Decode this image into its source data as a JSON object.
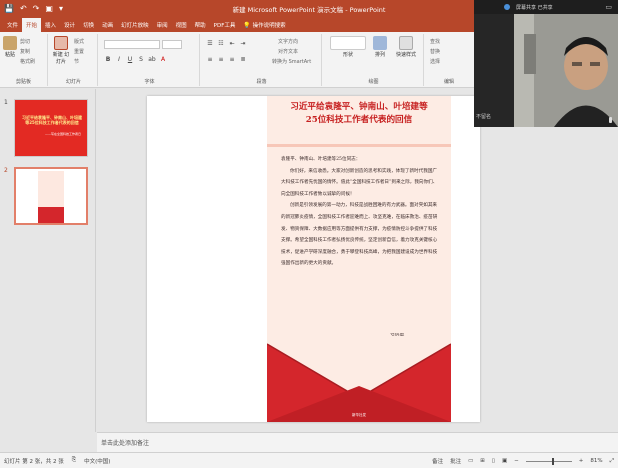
{
  "app": {
    "window_title": "新建 Microsoft PowerPoint 演示文稿 - PowerPoint",
    "quick_access": [
      "💾",
      "↶",
      "↷",
      "▣",
      "▾"
    ]
  },
  "tabs": [
    {
      "label": "文件"
    },
    {
      "label": "开始"
    },
    {
      "label": "插入"
    },
    {
      "label": "设计"
    },
    {
      "label": "切换"
    },
    {
      "label": "动画"
    },
    {
      "label": "幻灯片放映"
    },
    {
      "label": "审阅"
    },
    {
      "label": "视图"
    },
    {
      "label": "帮助"
    },
    {
      "label": "PDF工具"
    }
  ],
  "tell_me": "操作说明搜索",
  "ribbon": {
    "clipboard": {
      "paste": "粘贴",
      "cut": "剪切",
      "copy": "复制",
      "painter": "格式刷",
      "label": "剪贴板"
    },
    "slides": {
      "new_slide": "新建\n幻灯片",
      "layout": "版式",
      "reset": "重置",
      "section": "节",
      "label": "幻灯片"
    },
    "font": {
      "label": "字体",
      "format": [
        "B",
        "I",
        "U",
        "S",
        "ab",
        "A"
      ]
    },
    "paragraph": {
      "label": "段落",
      "convert_smartart": "转换为 SmartArt",
      "text_direction": "文字方向",
      "align_text": "对齐文本"
    },
    "drawing": {
      "shapes": "形状",
      "arrange": "排列",
      "quick_styles": "快速样式",
      "label": "绘图"
    },
    "editing": {
      "find": "查找",
      "replace": "替换",
      "select": "选择",
      "label": "编辑"
    }
  },
  "thumbnails": [
    {
      "num": "1",
      "title": "习近平给袁隆平、钟南山、叶培建等25位科技工作者代表的回信",
      "sub": "——写在全国科技工作者日"
    },
    {
      "num": "2"
    }
  ],
  "letter": {
    "title_line1": "习近平给袁隆平、钟南山、叶培建等",
    "title_line2": "25位科技工作者代表的回信",
    "salutation": "袁隆平、钟南山、叶培建等25位同志：",
    "para1": "你们好，来信收悉。大家对创新创造的思考和实践，体现了新时代我国广大科技工作者先忧国的情怀。值此“全国科技工作者日”到来之际，我向你们、向全国科技工作者致以诚挚的问候！",
    "para2": "创新是引领发展的第一动力，科技是战胜困难的有力武器。面对突如其来的新冠肺炎疫情，全国科技工作者迎难而上、攻坚克难，在临床救治、疫苗研发、物资保障、大数据应用等方面提供有力支撑，为疫情防控斗争提供了科技支撑。希望全国科技工作者弘扬优良传统，坚定创新自信，着力攻克关键核心技术，促进产学研深度融合，勇于攀登科技高峰，为把我国建设成为世界科技强国作出新的更大的贡献。",
    "signature": "习近平",
    "date": "2020年5月29日",
    "logo_text": "新华社发"
  },
  "notes_placeholder": "单击此处添加备注",
  "status": {
    "slide_info": "幻灯片 第 2 张，共 2 张",
    "language": "中文(中国)",
    "notes": "备注",
    "comments": "批注",
    "zoom": "81%"
  },
  "video": {
    "title": "屏幕共享",
    "state": "已共享",
    "participant": "不留名"
  },
  "colors": {
    "accent": "#b7472a",
    "letter_title": "#c61f1f",
    "envelope": "#d4262c"
  }
}
